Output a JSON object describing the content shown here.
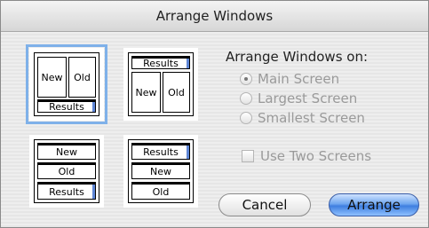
{
  "window": {
    "title": "Arrange Windows"
  },
  "layouts": [
    {
      "name": "side-by-side-results-bottom",
      "selected": true,
      "labels": [
        "New",
        "Old",
        "Results"
      ]
    },
    {
      "name": "results-top-side-by-side",
      "selected": false,
      "labels": [
        "Results",
        "New",
        "Old"
      ]
    },
    {
      "name": "stacked-new-old-results",
      "selected": false,
      "labels": [
        "New",
        "Old",
        "Results"
      ]
    },
    {
      "name": "stacked-results-new-old",
      "selected": false,
      "labels": [
        "Results",
        "New",
        "Old"
      ]
    }
  ],
  "arrange_on": {
    "label": "Arrange Windows on:",
    "options": [
      {
        "label": "Main Screen",
        "checked": true
      },
      {
        "label": "Largest Screen",
        "checked": false
      },
      {
        "label": "Smallest Screen",
        "checked": false
      }
    ]
  },
  "use_two_screens": {
    "label": "Use Two Screens",
    "checked": false
  },
  "buttons": {
    "cancel": "Cancel",
    "arrange": "Arrange"
  },
  "colors": {
    "accent": "#3f7fe0",
    "selection": "#7fb1e9"
  }
}
